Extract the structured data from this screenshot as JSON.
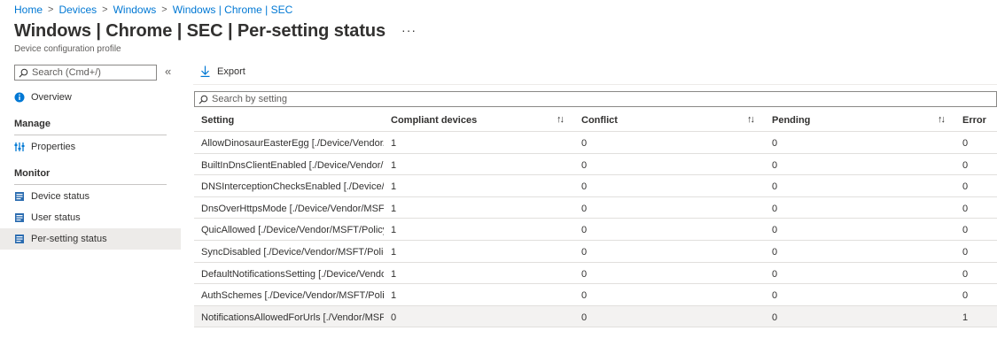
{
  "breadcrumb": [
    "Home",
    "Devices",
    "Windows",
    "Windows | Chrome | SEC"
  ],
  "page": {
    "title": "Windows | Chrome | SEC | Per-setting status",
    "more": "···",
    "subtitle": "Device configuration profile"
  },
  "sidebar": {
    "search_placeholder": "Search (Cmd+/)",
    "collapse": "«",
    "overview": "Overview",
    "manage_header": "Manage",
    "properties": "Properties",
    "monitor_header": "Monitor",
    "device_status": "Device status",
    "user_status": "User status",
    "per_setting_status": "Per-setting status"
  },
  "toolbar": {
    "export_label": "Export"
  },
  "grid": {
    "search_placeholder": "Search by setting",
    "columns": [
      "Setting",
      "Compliant devices",
      "Conflict",
      "Pending",
      "Error"
    ],
    "sort_glyph": "↑↓",
    "rows": [
      {
        "setting": "AllowDinosaurEasterEgg [./Device/Vendor/M...",
        "compliant": "1",
        "conflict": "0",
        "pending": "0",
        "error": "0"
      },
      {
        "setting": "BuiltInDnsClientEnabled [./Device/Vendor/M...",
        "compliant": "1",
        "conflict": "0",
        "pending": "0",
        "error": "0"
      },
      {
        "setting": "DNSInterceptionChecksEnabled [./Device/Ve...",
        "compliant": "1",
        "conflict": "0",
        "pending": "0",
        "error": "0"
      },
      {
        "setting": "DnsOverHttpsMode [./Device/Vendor/MSFT/...",
        "compliant": "1",
        "conflict": "0",
        "pending": "0",
        "error": "0"
      },
      {
        "setting": "QuicAllowed [./Device/Vendor/MSFT/Policy/...",
        "compliant": "1",
        "conflict": "0",
        "pending": "0",
        "error": "0"
      },
      {
        "setting": "SyncDisabled [./Device/Vendor/MSFT/Policy/...",
        "compliant": "1",
        "conflict": "0",
        "pending": "0",
        "error": "0"
      },
      {
        "setting": "DefaultNotificationsSetting [./Device/Vendor...",
        "compliant": "1",
        "conflict": "0",
        "pending": "0",
        "error": "0"
      },
      {
        "setting": "AuthSchemes [./Device/Vendor/MSFT/Policy/...",
        "compliant": "1",
        "conflict": "0",
        "pending": "0",
        "error": "0"
      },
      {
        "setting": "NotificationsAllowedForUrls [./Vendor/MSFT/...",
        "compliant": "0",
        "conflict": "0",
        "pending": "0",
        "error": "1"
      }
    ]
  },
  "icons": {
    "overview": "info-icon",
    "properties": "sliders-icon",
    "device_status": "list-icon",
    "user_status": "list-icon",
    "per_setting_status": "list-icon",
    "export": "download-arrow-icon",
    "search": "search-icon"
  },
  "colors": {
    "link": "#0078d4",
    "active_row": "#edebe9",
    "highlight_row": "#f3f2f1"
  }
}
